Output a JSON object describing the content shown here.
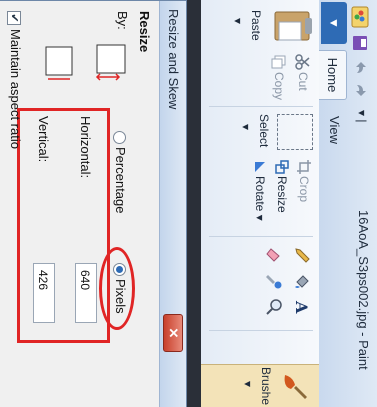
{
  "window": {
    "title": "16AoA_S3ps002.jpg - Paint",
    "file_tab_label": "▼",
    "tabs": [
      "Home",
      "View"
    ]
  },
  "ribbon": {
    "clipboard": {
      "paste_label": "Paste",
      "cut_label": "Cut",
      "copy_label": "Copy"
    },
    "image": {
      "select_label": "Select",
      "crop_label": "Crop",
      "resize_label": "Resize",
      "rotate_label": "Rotate ▾"
    },
    "brushes_label": "Brushe"
  },
  "dialog": {
    "title": "Resize and Skew",
    "section_label": "Resize",
    "by_label": "By:",
    "percentage_label": "Percentage",
    "pixels_label": "Pixels",
    "selected_unit": "Pixels",
    "horizontal_label": "Horizontal:",
    "horizontal_value": "640",
    "vertical_label": "Vertical:",
    "vertical_value": "426",
    "maintain_aspect_label": "Maintain aspect ratio",
    "maintain_aspect_checked": true
  },
  "colors": {
    "annotation_red": "#e02525",
    "accent_blue": "#2e6bb5"
  }
}
